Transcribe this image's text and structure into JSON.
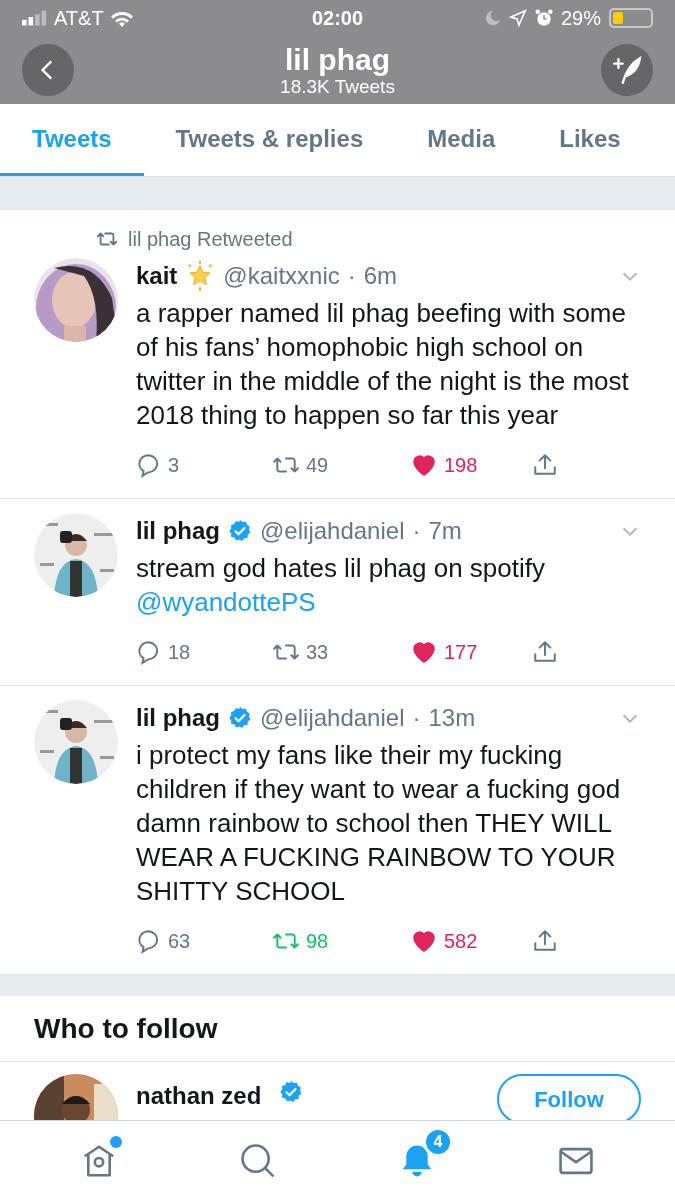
{
  "status_bar": {
    "carrier": "AT&T",
    "time": "02:00",
    "battery": "29%"
  },
  "header": {
    "title": "lil phag",
    "subtitle": "18.3K Tweets"
  },
  "tabs": [
    {
      "label": "Tweets",
      "selected": true
    },
    {
      "label": "Tweets & replies",
      "selected": false
    },
    {
      "label": "Media",
      "selected": false
    },
    {
      "label": "Likes",
      "selected": false
    }
  ],
  "tweets": [
    {
      "retweet_label": "lil phag Retweeted",
      "name": "kait",
      "star_badge": true,
      "verified": false,
      "handle": "@kaitxxnic",
      "dot": "·",
      "time": "6m",
      "text": [
        {
          "kind": "plain",
          "text": "a rapper named lil phag beefing with some of his fans’ homophobic high school on twitter in the middle of the night is the most 2018 thing to happen so far this year"
        }
      ],
      "replies": "3",
      "retweets": "49",
      "retweeted": false,
      "likes": "198",
      "liked": true
    },
    {
      "name": "lil phag",
      "verified": true,
      "star_badge": false,
      "handle": "@elijahdaniel",
      "dot": "·",
      "time": "7m",
      "text": [
        {
          "kind": "plain",
          "text": "stream god hates lil phag on spotify"
        },
        {
          "kind": "mention",
          "text": "@wyandottePS"
        }
      ],
      "replies": "18",
      "retweets": "33",
      "retweeted": false,
      "likes": "177",
      "liked": true
    },
    {
      "name": "lil phag",
      "verified": true,
      "star_badge": false,
      "handle": "@elijahdaniel",
      "dot": "·",
      "time": "13m",
      "text": [
        {
          "kind": "plain",
          "text": "i protect my fans like their my fucking children if they want to wear a fucking god damn rainbow to school then THEY WILL WEAR A FUCKING RAINBOW TO YOUR SHITTY SCHOOL"
        }
      ],
      "replies": "63",
      "retweets": "98",
      "retweeted": true,
      "likes": "582",
      "liked": true
    }
  ],
  "who_to_follow": {
    "title": "Who to follow",
    "accounts": [
      {
        "name": "nathan zed",
        "verified": true,
        "button": "Follow"
      }
    ]
  },
  "tab_bar": {
    "home_new": true,
    "notifications": "4"
  }
}
